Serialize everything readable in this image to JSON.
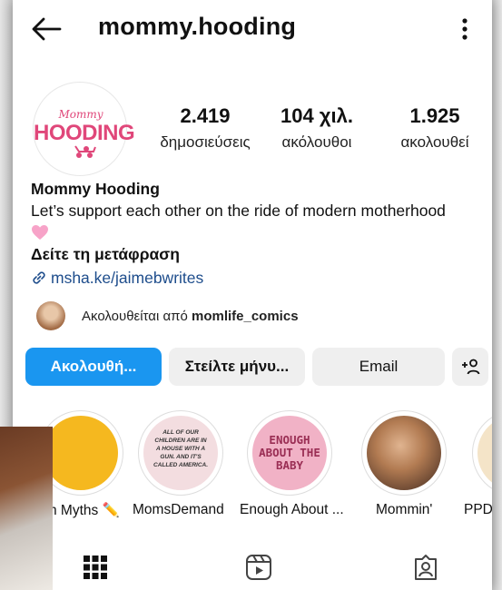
{
  "header": {
    "username": "mommy.hooding"
  },
  "avatar": {
    "logo_script": "Mommy",
    "logo_main": "HOODING"
  },
  "stats": [
    {
      "value": "2.419",
      "label": "δημοσιεύσεις"
    },
    {
      "value": "104 χιλ.",
      "label": "ακόλουθοι"
    },
    {
      "value": "1.925",
      "label": "ακολουθεί"
    }
  ],
  "bio": {
    "name": "Mommy Hooding",
    "text": "Let’s support each other on the ride of modern motherhood",
    "translate": "Δείτε τη μετάφραση",
    "link": "msha.ke/jaimebwrites"
  },
  "followed_by": {
    "prefix": "Ακολουθείται από ",
    "user": "momlife_comics"
  },
  "buttons": {
    "follow": "Ακολουθή...",
    "message": "Στείλτε μήνυ...",
    "email": "Email"
  },
  "highlights": [
    {
      "label": "h Myths ✏️",
      "cover_text": ""
    },
    {
      "label": "MomsDemand",
      "cover_text": "ALL OF OUR CHILDREN ARE IN A HOUSE WITH A GUN. AND IT'S CALLED AMERICA."
    },
    {
      "label": "Enough About ...",
      "cover_text": "ENOUGH ABOUT THE BABY"
    },
    {
      "label": "Mommin'",
      "cover_text": ""
    },
    {
      "label": "PPD",
      "cover_text": ""
    }
  ],
  "colors": {
    "primary_button": "#1a96f0",
    "link": "#1e4d8c",
    "logo_pink": "#e0477a"
  }
}
